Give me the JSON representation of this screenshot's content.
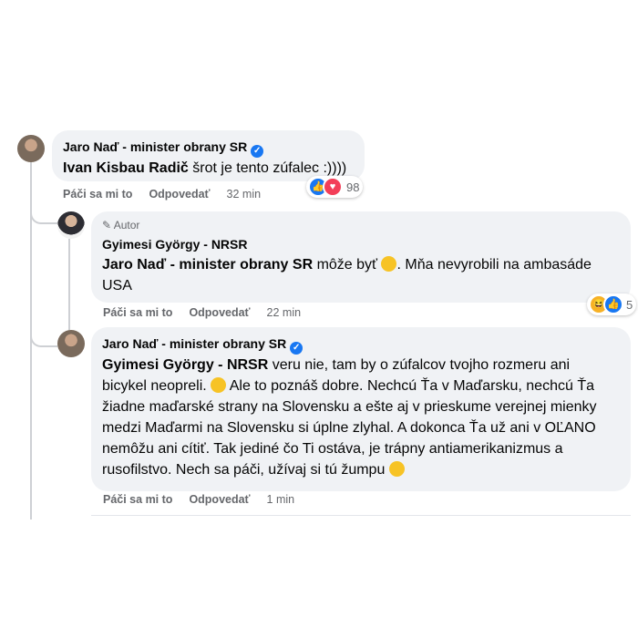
{
  "comments": [
    {
      "author": "Jaro Naď - minister obrany SR",
      "mention": "Ivan Kisbau Radič",
      "text": " šrot je tento zúfalec :))))",
      "actions": {
        "like": "Páči sa mi to",
        "reply": "Odpovedať",
        "time": "32 min"
      },
      "reaction_count": "98"
    },
    {
      "badge": "Autor",
      "author": "Gyimesi György - NRSR",
      "mention": "Jaro Naď - minister obrany SR",
      "text_a": " môže byť ",
      "text_b": ". Mňa nevyrobili na ambasáde USA",
      "actions": {
        "like": "Páči sa mi to",
        "reply": "Odpovedať",
        "time": "22 min"
      },
      "reaction_count": "5"
    },
    {
      "author": "Jaro Naď - minister obrany SR",
      "mention": "Gyimesi György - NRSR",
      "text_l1": " veru nie, tam by o zúfalcov tvojho rozmeru ani",
      "text_l2a": "bicykel neopreli. ",
      "text_l2b": " Ale to poznáš dobre. Nechcú Ťa v Maďarsku, nechcú Ťa",
      "text_l3": "žiadne maďarské strany na Slovensku a ešte aj v prieskume verejnej mienky",
      "text_l4": "medzi Maďarmi na Slovensku si úplne zlyhal. A dokonca Ťa už ani v OĽANO",
      "text_l5": "nemôžu ani cítiť. Tak jediné čo Ti ostáva, je trápny antiamerikanizmus a",
      "text_l6": "rusofilstvo. Nech sa páči, užívaj si tú žumpu ",
      "actions": {
        "like": "Páči sa mi to",
        "reply": "Odpovedať",
        "time": "1 min"
      }
    }
  ],
  "colors": {
    "bubble": "#f0f2f5",
    "link": "#1877f2",
    "meta": "#65676b"
  },
  "icons": [
    "avatar",
    "verified-badge-icon",
    "like-reaction-icon",
    "love-reaction-icon",
    "haha-reaction-icon",
    "pencil-icon",
    "emoji-icon"
  ]
}
